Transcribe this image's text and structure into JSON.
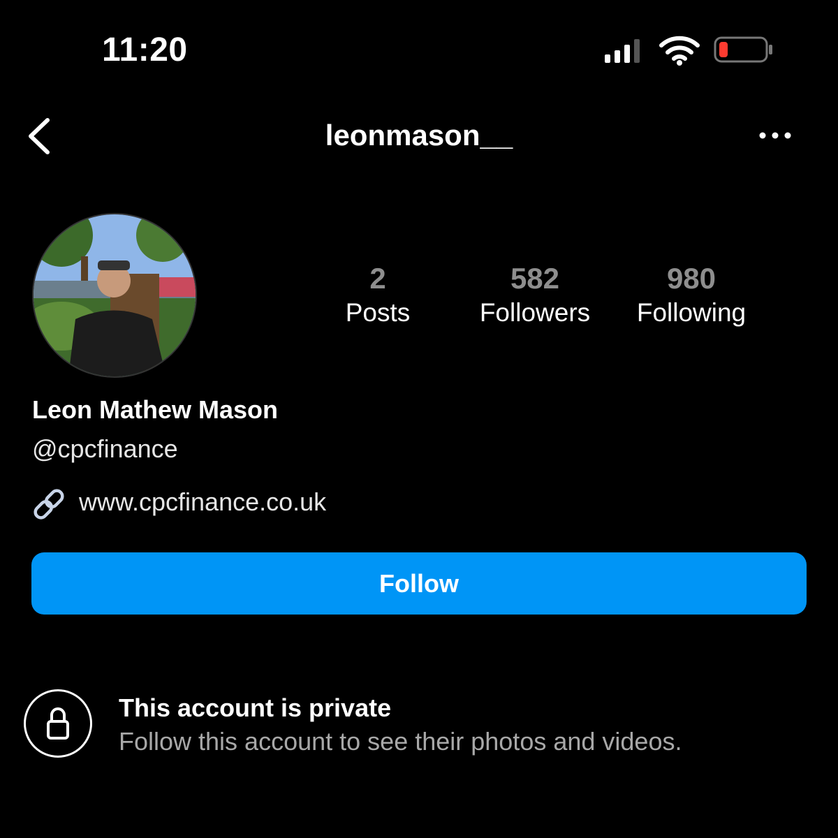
{
  "status_bar": {
    "time": "11:20",
    "signal_icon": "signal-bars-icon",
    "wifi_icon": "wifi-icon",
    "battery_icon": "battery-low-icon",
    "battery_color": "#ff3b30"
  },
  "header": {
    "back_icon": "chevron-left-icon",
    "username": "leonmason__",
    "more_icon": "ellipsis-icon"
  },
  "profile": {
    "avatar_icon": "profile-photo",
    "stats": [
      {
        "value": "2",
        "label": "Posts"
      },
      {
        "value": "582",
        "label": "Followers"
      },
      {
        "value": "980",
        "label": "Following"
      }
    ],
    "full_name": "Leon Mathew Mason",
    "handle": "@cpcfinance",
    "link_icon": "link-icon",
    "website": "www.cpcfinance.co.uk"
  },
  "actions": {
    "follow_label": "Follow",
    "follow_color": "#0095f6"
  },
  "private_notice": {
    "lock_icon": "lock-icon",
    "title": "This account is private",
    "subtitle": "Follow this account to see their photos and videos."
  }
}
